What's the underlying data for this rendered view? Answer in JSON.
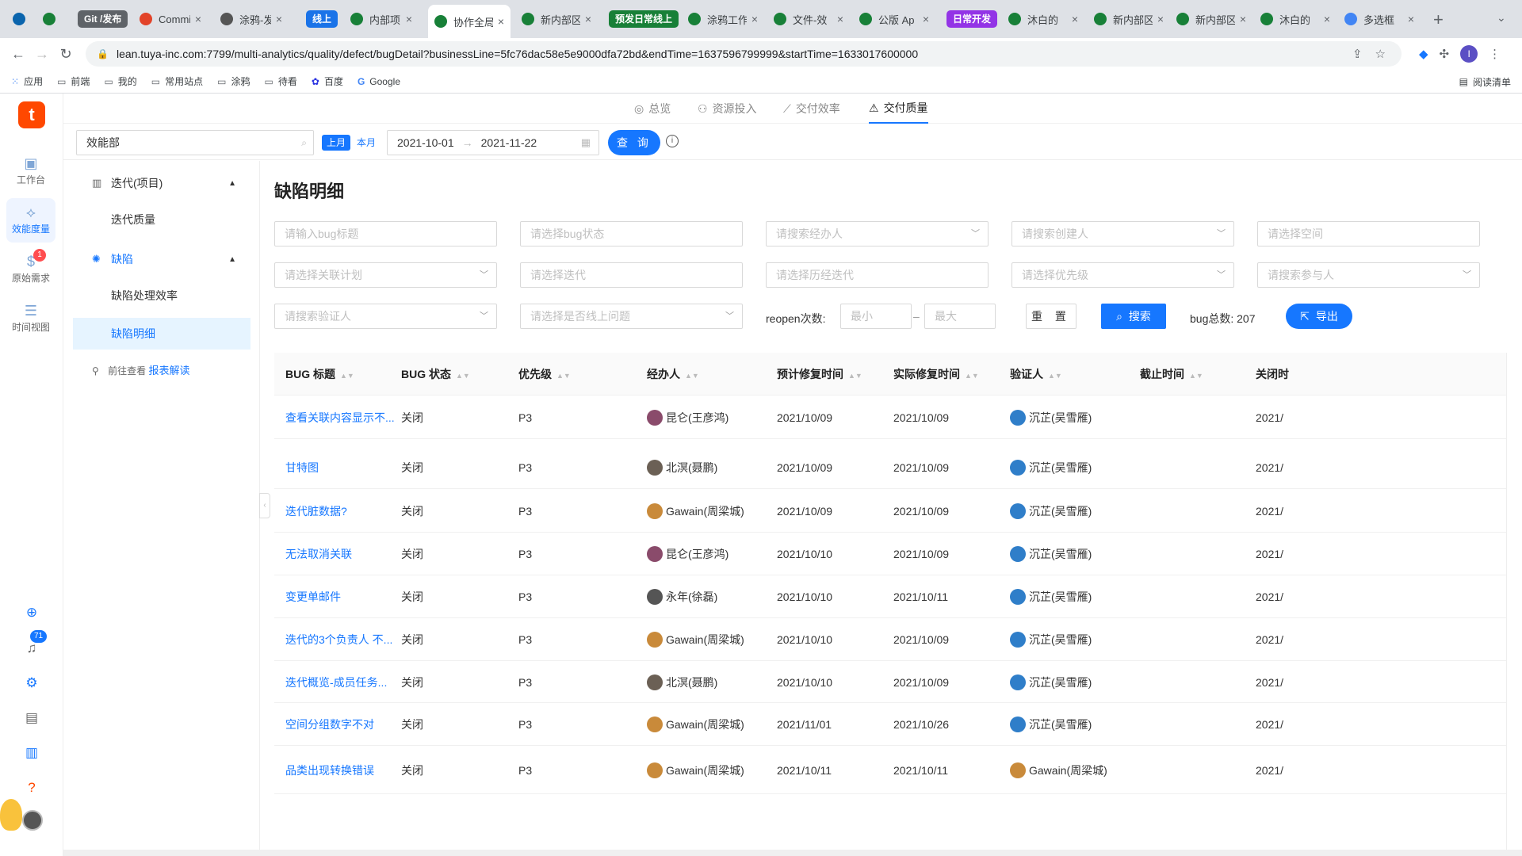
{
  "browser": {
    "tabs": [
      {
        "title": "",
        "color": "#0a64ad"
      },
      {
        "title": "",
        "color": "#188038"
      },
      {
        "title": "Commit",
        "color": "#e24329"
      },
      {
        "title": "涂鸦-发",
        "color": "#555555"
      },
      {
        "title": "内部项目",
        "color": "#188038"
      },
      {
        "title": "协作全局",
        "color": "#188038"
      },
      {
        "title": "新内部区",
        "color": "#188038"
      },
      {
        "title": "涂鸦工作",
        "color": "#188038"
      },
      {
        "title": "文件-效",
        "color": "#188038"
      },
      {
        "title": "公版 Ap",
        "color": "#188038"
      },
      {
        "title": "沐白的",
        "color": "#188038"
      },
      {
        "title": "新内部区",
        "color": "#188038"
      },
      {
        "title": "新内部区",
        "color": "#188038"
      },
      {
        "title": "沐白的",
        "color": "#188038"
      },
      {
        "title": "多选框",
        "color": "#4285f4"
      }
    ],
    "groups": [
      {
        "label": "Git /发布",
        "color": "#5f6368"
      },
      {
        "label": "线上",
        "color": "#1a73e8"
      },
      {
        "label": "预发日常线上",
        "color": "#188038"
      },
      {
        "label": "日常开发",
        "color": "#9334e6"
      }
    ],
    "url": "lean.tuya-inc.com:7799/multi-analytics/quality/defect/bugDetail?businessLine=5fc76dac58e5e9000dfa72bd&endTime=1637596799999&startTime=1633017600000",
    "profile_initial": "I",
    "bookmarks": [
      "应用",
      "前端",
      "我的",
      "常用站点",
      "涂鸦",
      "待看",
      "百度",
      "Google"
    ],
    "reading_list": "阅读清单"
  },
  "rail": {
    "logo": "t",
    "items": [
      {
        "label": "工作台",
        "icon": "workbench-icon"
      },
      {
        "label": "效能度量",
        "icon": "metrics-icon"
      },
      {
        "label": "原始需求",
        "icon": "requirement-icon",
        "badge": "1"
      },
      {
        "label": "时间视图",
        "icon": "timeline-icon"
      }
    ],
    "bell_badge": "71"
  },
  "module_nav": {
    "tabs": [
      "总览",
      "资源投入",
      "交付效率",
      "交付质量"
    ],
    "active": "交付质量"
  },
  "top_filter": {
    "department": "效能部",
    "last_month": "上月",
    "this_month": "本月",
    "start_date": "2021-10-01",
    "end_date": "2021-11-22",
    "query_label": "查 询"
  },
  "side_menu": {
    "group1": "迭代(项目)",
    "group1_items": [
      "迭代质量"
    ],
    "group2": "缺陷",
    "group2_items": [
      "缺陷处理效率",
      "缺陷明细"
    ],
    "active_item": "缺陷明细",
    "report_prefix": "前往查看",
    "report_link": "报表解读"
  },
  "content": {
    "title": "缺陷明细",
    "filters": {
      "bug_title": "请输入bug标题",
      "bug_status": "请选择bug状态",
      "handler": "请搜索经办人",
      "creator": "请搜索创建人",
      "space": "请选择空间",
      "plan": "请选择关联计划",
      "iteration": "请选择迭代",
      "history_iteration": "请选择历经迭代",
      "priority": "请选择优先级",
      "participant": "请搜索参与人",
      "verifier": "请搜索验证人",
      "online_issue": "请选择是否线上问题",
      "reopen_label": "reopen次数:",
      "reopen_min": "最小",
      "reopen_max": "最大"
    },
    "reset_label": "重 置",
    "search_label": "搜索",
    "bug_total_label": "bug总数:",
    "bug_total": "207",
    "export_label": "导出"
  },
  "table": {
    "headers": [
      "BUG 标题",
      "BUG 状态",
      "优先级",
      "经办人",
      "预计修复时间",
      "实际修复时间",
      "验证人",
      "截止时间",
      "关闭时"
    ],
    "rows": [
      {
        "title": "查看关联内容显示不...",
        "status": "关闭",
        "priority": "P3",
        "handler": "昆仑(王彦鸿)",
        "handler_color": "#8a4b6b",
        "est": "2021/10/09",
        "actual": "2021/10/09",
        "verifier": "沉芷(吴雪雁)",
        "verifier_color": "#2f7ec9",
        "deadline": "",
        "closed": "2021/"
      },
      {
        "title": "甘特图",
        "status": "关闭",
        "priority": "P3",
        "handler": "北溟(聂鹏)",
        "handler_color": "#6b6055",
        "est": "2021/10/09",
        "actual": "2021/10/09",
        "verifier": "沉芷(吴雪雁)",
        "verifier_color": "#2f7ec9",
        "deadline": "",
        "closed": "2021/"
      },
      {
        "title": "迭代脏数据?",
        "status": "关闭",
        "priority": "P3",
        "handler": "Gawain(周梁城)",
        "handler_color": "#c98a3a",
        "est": "2021/10/09",
        "actual": "2021/10/09",
        "verifier": "沉芷(吴雪雁)",
        "verifier_color": "#2f7ec9",
        "deadline": "",
        "closed": "2021/"
      },
      {
        "title": "无法取消关联",
        "status": "关闭",
        "priority": "P3",
        "handler": "昆仑(王彦鸿)",
        "handler_color": "#8a4b6b",
        "est": "2021/10/10",
        "actual": "2021/10/09",
        "verifier": "沉芷(吴雪雁)",
        "verifier_color": "#2f7ec9",
        "deadline": "",
        "closed": "2021/"
      },
      {
        "title": "变更单邮件",
        "status": "关闭",
        "priority": "P3",
        "handler": "永年(徐磊)",
        "handler_color": "#555555",
        "est": "2021/10/10",
        "actual": "2021/10/11",
        "verifier": "沉芷(吴雪雁)",
        "verifier_color": "#2f7ec9",
        "deadline": "",
        "closed": "2021/"
      },
      {
        "title": "迭代的3个负责人 不...",
        "status": "关闭",
        "priority": "P3",
        "handler": "Gawain(周梁城)",
        "handler_color": "#c98a3a",
        "est": "2021/10/10",
        "actual": "2021/10/09",
        "verifier": "沉芷(吴雪雁)",
        "verifier_color": "#2f7ec9",
        "deadline": "",
        "closed": "2021/"
      },
      {
        "title": "迭代概览-成员任务...",
        "status": "关闭",
        "priority": "P3",
        "handler": "北溟(聂鹏)",
        "handler_color": "#6b6055",
        "est": "2021/10/10",
        "actual": "2021/10/09",
        "verifier": "沉芷(吴雪雁)",
        "verifier_color": "#2f7ec9",
        "deadline": "",
        "closed": "2021/"
      },
      {
        "title": "空间分组数字不对",
        "status": "关闭",
        "priority": "P3",
        "handler": "Gawain(周梁城)",
        "handler_color": "#c98a3a",
        "est": "2021/11/01",
        "actual": "2021/10/26",
        "verifier": "沉芷(吴雪雁)",
        "verifier_color": "#2f7ec9",
        "deadline": "",
        "closed": "2021/"
      },
      {
        "title": "品类出现转换错误",
        "status": "关闭",
        "priority": "P3",
        "handler": "Gawain(周梁城)",
        "handler_color": "#c98a3a",
        "est": "2021/10/11",
        "actual": "2021/10/11",
        "verifier": "Gawain(周梁城)",
        "verifier_color": "#c98a3a",
        "deadline": "",
        "closed": "2021/"
      }
    ]
  }
}
